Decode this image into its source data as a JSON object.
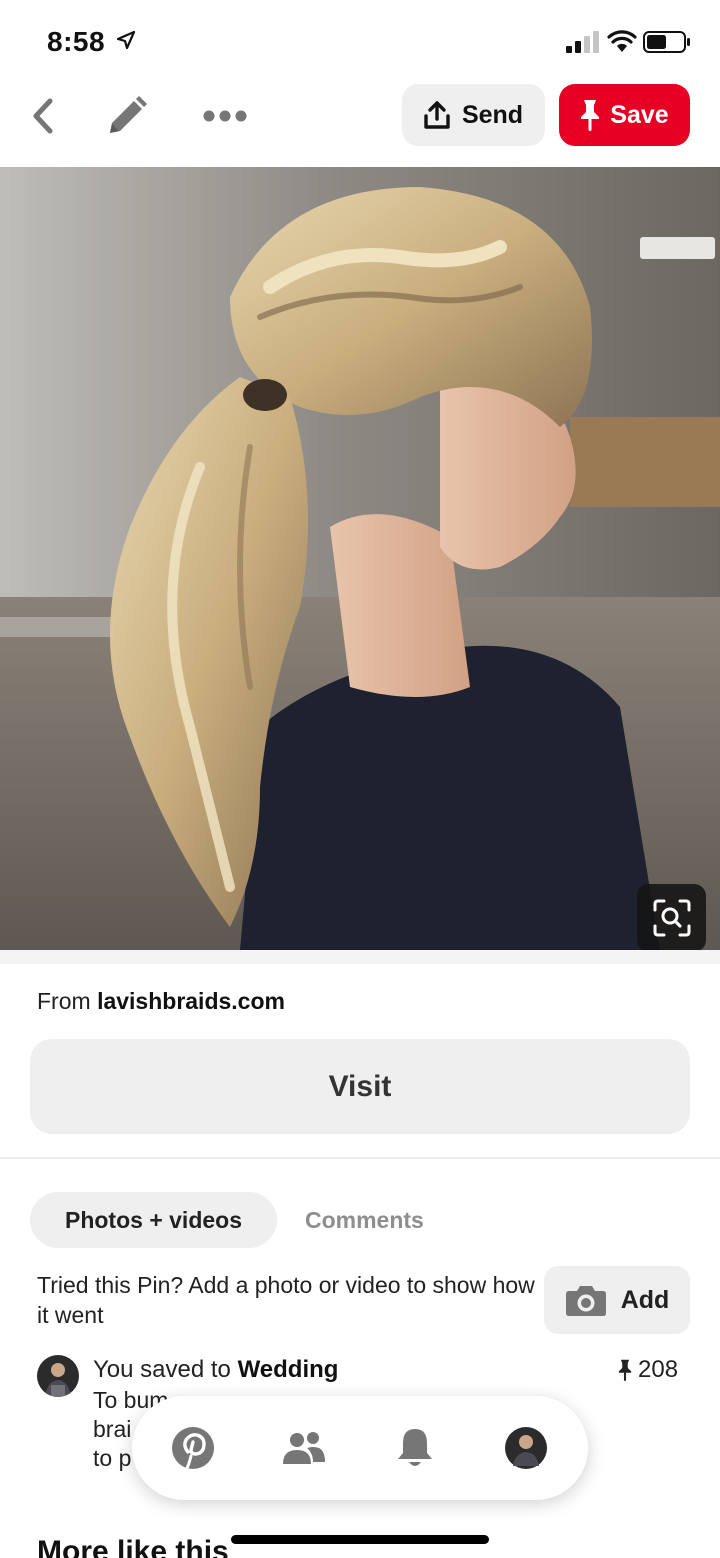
{
  "status_bar": {
    "time": "8:58",
    "icons": [
      "location-arrow-icon",
      "cellular-signal-icon",
      "wifi-icon",
      "battery-icon"
    ]
  },
  "toolbar": {
    "icons": [
      "chevron-left-icon",
      "pencil-icon",
      "more-dots-icon",
      "share-upload-icon",
      "pushpin-icon"
    ],
    "send_label": "Send",
    "save_label": "Save",
    "save_color": "#e60023"
  },
  "pin": {
    "image_icons": [
      "visual-search-icon"
    ],
    "from_prefix": "From",
    "source_domain": "lavishbraids.com",
    "visit_label": "Visit"
  },
  "tabs": {
    "photos_label": "Photos + videos",
    "comments_label": "Comments"
  },
  "tried": {
    "prompt": "Tried this Pin? Add a photo or video to show how it went",
    "add_label": "Add",
    "add_icon": "camera-icon"
  },
  "saved": {
    "prefix": "You saved to",
    "board": "Wedding",
    "pin_count": "208",
    "description_fragments": [
      "To bum",
      "brai",
      "to p"
    ]
  },
  "bottom_nav": {
    "items": [
      "pinterest-logo-icon",
      "following-people-icon",
      "notifications-bell-icon",
      "profile-avatar"
    ]
  },
  "more_like_this": "More like this"
}
